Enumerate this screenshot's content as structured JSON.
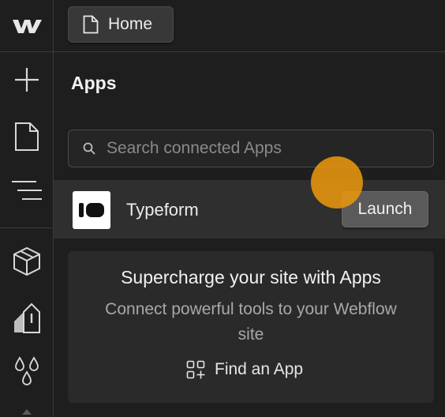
{
  "rail": {
    "items": [
      {
        "name": "webflow-logo-icon"
      },
      {
        "name": "add-icon"
      },
      {
        "name": "pages-icon"
      },
      {
        "name": "navigator-icon"
      },
      {
        "name": "components-icon"
      },
      {
        "name": "style-manager-icon"
      },
      {
        "name": "variables-icon"
      }
    ]
  },
  "topbar": {
    "page_label": "Home",
    "page_icon": "page-icon"
  },
  "panel": {
    "title": "Apps",
    "search_placeholder": "Search connected Apps",
    "search_icon": "search-icon"
  },
  "apps": [
    {
      "name": "Typeform",
      "action_label": "Launch",
      "logo_icon": "typeform-logo-icon"
    }
  ],
  "promo": {
    "title": "Supercharge your site with Apps",
    "subtitle": "Connect powerful tools to your Webflow site",
    "cta_label": "Find an App",
    "cta_icon": "apps-grid-add-icon"
  },
  "colors": {
    "background": "#1e1e1e",
    "row_highlight": "#2f2f2f",
    "cursor_indicator": "#e8960e"
  }
}
